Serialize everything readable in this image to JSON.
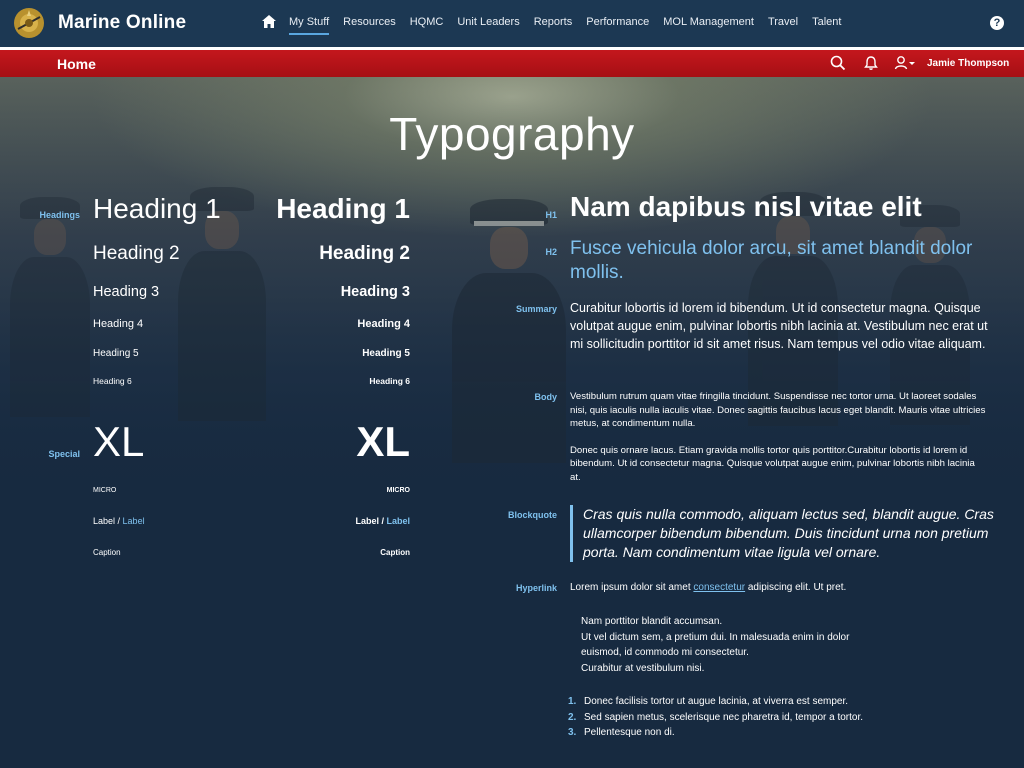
{
  "app": {
    "title": "Marine Online"
  },
  "nav": {
    "items": [
      "My Stuff",
      "Resources",
      "HQMC",
      "Unit Leaders",
      "Reports",
      "Performance",
      "MOL Management",
      "Travel",
      "Talent"
    ],
    "active": "My Stuff"
  },
  "subbar": {
    "page": "Home",
    "user_name": "Jamie Thompson"
  },
  "page_title": "Typography",
  "labels": {
    "headings": "Headings",
    "special": "Special",
    "h1": "H1",
    "h2": "H2",
    "summary": "Summary",
    "body": "Body",
    "blockquote": "Blockquote",
    "hyperlink": "Hyperlink"
  },
  "headings": [
    "Heading 1",
    "Heading 2",
    "Heading 3",
    "Heading 4",
    "Heading 5",
    "Heading 6"
  ],
  "special": {
    "xl": "XL",
    "micro": "MICRO",
    "label_a": "Label",
    "label_sep": " / ",
    "label_b": "Label",
    "caption": "Caption"
  },
  "content": {
    "h1": "Nam dapibus nisl vitae elit",
    "h2": "Fusce vehicula dolor arcu, sit amet blandit dolor mollis.",
    "summary": "Curabitur lobortis id lorem id bibendum. Ut id consectetur magna. Quisque volutpat augue enim, pulvinar lobortis nibh lacinia at. Vestibulum nec erat ut mi sollicitudin porttitor id sit amet risus. Nam tempus vel odio vitae aliquam.",
    "body_p1": "Vestibulum rutrum quam vitae fringilla tincidunt. Suspendisse nec tortor urna. Ut laoreet sodales nisi, quis iaculis nulla iaculis vitae. Donec sagittis faucibus lacus eget blandit. Mauris vitae ultricies metus, at condimentum nulla.",
    "body_p2": "Donec quis ornare lacus. Etiam gravida mollis tortor quis porttitor.Curabitur lobortis id lorem id bibendum. Ut id consectetur magna. Quisque volutpat augue enim, pulvinar lobortis nibh lacinia at.",
    "blockquote": "Cras quis nulla commodo, aliquam lectus sed, blandit augue. Cras ullamcorper bibendum bibendum. Duis tincidunt urna non pretium porta. Nam condimentum vitae ligula vel ornare.",
    "hyper_before": "Lorem ipsum dolor sit amet ",
    "hyper_link": "consectetur",
    "hyper_after": " adipiscing elit. Ut pret.",
    "address": [
      "Nam porttitor blandit accumsan.",
      "Ut vel dictum sem, a pretium dui. In malesuada enim in dolor",
      "euismod, id commodo mi consectetur.",
      "Curabitur at vestibulum nisi."
    ],
    "list": [
      {
        "num": "1.",
        "text": "Donec facilisis tortor ut augue lacinia, at viverra est semper."
      },
      {
        "num": "2.",
        "text": "Sed sapien metus, scelerisque nec pharetra id, tempor a tortor."
      },
      {
        "num": "3.",
        "text": "Pellentesque non di."
      }
    ]
  },
  "colors": {
    "navy": "#1c3853",
    "red": "#b5131a",
    "accent": "#7fc1ee",
    "background": "#172a40"
  },
  "icons": [
    "emblem-logo",
    "home-icon",
    "help-icon",
    "search-icon",
    "bell-icon",
    "user-icon",
    "caret-down-icon"
  ]
}
